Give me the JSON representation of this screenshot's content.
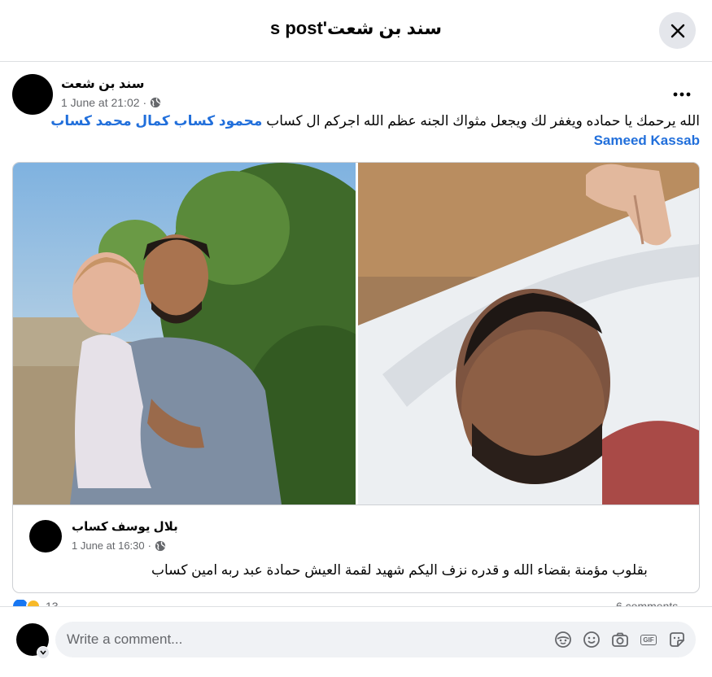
{
  "header": {
    "title": "s post'سند بن شعت"
  },
  "post": {
    "author": "سند بن شعت",
    "date": "1 June at 21:02",
    "separator": "·",
    "text_main": "الله يرحمك يا حماده ويغفر لك ويجعل مثواك الجنه عظم الله اجركم ال كساب",
    "tag_1": "محمود كساب كمال محمد كساب",
    "tag_2": "Sameed Kassab"
  },
  "shared": {
    "author": "بلال يوسف كساب",
    "date": "1 June at 16:30",
    "separator": "·",
    "text": "بقلوب مؤمنة بقضاء الله و قدره نزف اليكم شهيد لقمة العيش حمادة عبد ربه امين كساب"
  },
  "counts": {
    "reactions": "13",
    "comments": "6 comments"
  },
  "composer": {
    "placeholder": "Write a comment..."
  },
  "icons": {
    "close": "close-icon",
    "more": "more-options-icon",
    "audience": "globe-icon",
    "avatar_sticker": "avatar-sticker-icon",
    "emoji": "emoji-icon",
    "camera": "camera-icon",
    "gif": "GIF",
    "sticker": "sticker-icon"
  },
  "colors": {
    "link": "#216fdb",
    "meta": "#65676b",
    "input_bg": "#f0f2f5",
    "close_bg": "#e4e6eb"
  }
}
